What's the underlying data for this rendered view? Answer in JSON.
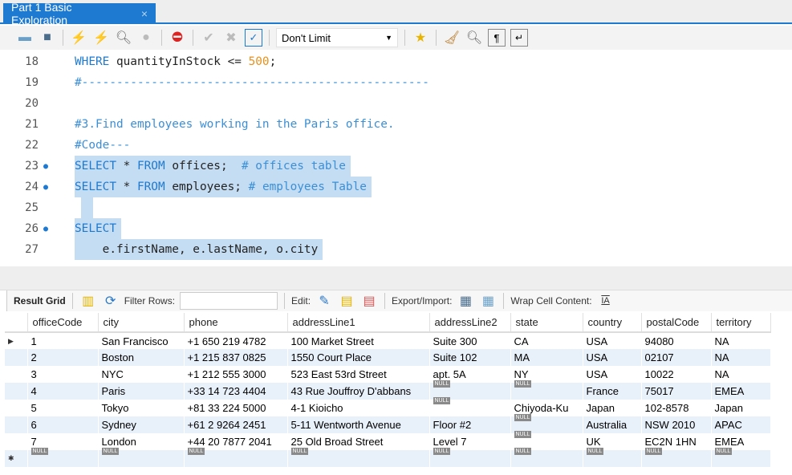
{
  "tab": {
    "title": "Part 1 Basic Exploration",
    "close": "×"
  },
  "toolbar": {
    "limit": "Don't Limit",
    "icons": [
      "open-folder-icon",
      "save-icon",
      "execute-icon",
      "execute-current-icon",
      "explain-icon",
      "stop-icon",
      "toggle-error-icon",
      "commit-icon",
      "rollback-icon",
      "autocommit-icon",
      "add-snippet-icon",
      "beautify-icon",
      "find-icon",
      "invisible-chars-icon",
      "wrap-icon"
    ]
  },
  "editor": {
    "lines": [
      {
        "n": "18",
        "dot": false,
        "sel": false,
        "tokens": [
          [
            "kw",
            "WHERE "
          ],
          [
            "id",
            "quantityInStock <= "
          ],
          [
            "num",
            "500"
          ],
          [
            "id",
            ";"
          ]
        ]
      },
      {
        "n": "19",
        "dot": false,
        "sel": false,
        "tokens": [
          [
            "cm",
            "#--------------------------------------------------"
          ]
        ]
      },
      {
        "n": "20",
        "dot": false,
        "sel": false,
        "tokens": []
      },
      {
        "n": "21",
        "dot": false,
        "sel": false,
        "tokens": [
          [
            "cm",
            "#3.Find employees working in the Paris office."
          ]
        ]
      },
      {
        "n": "22",
        "dot": false,
        "sel": false,
        "tokens": [
          [
            "cm",
            "#Code---"
          ]
        ]
      },
      {
        "n": "23",
        "dot": true,
        "sel": true,
        "tokens": [
          [
            "kw",
            "SELECT "
          ],
          [
            "id",
            "* "
          ],
          [
            "kw",
            "FROM "
          ],
          [
            "id",
            "offices;  "
          ],
          [
            "cm",
            "# offices table"
          ]
        ]
      },
      {
        "n": "24",
        "dot": true,
        "sel": true,
        "tokens": [
          [
            "kw",
            "SELECT "
          ],
          [
            "id",
            "* "
          ],
          [
            "kw",
            "FROM "
          ],
          [
            "id",
            "employees; "
          ],
          [
            "cm",
            "# employees Table"
          ]
        ]
      },
      {
        "n": "25",
        "dot": false,
        "sel": true,
        "tokens": [
          [
            "id",
            " "
          ]
        ]
      },
      {
        "n": "26",
        "dot": true,
        "sel": true,
        "tokens": [
          [
            "kw",
            "SELECT"
          ]
        ]
      },
      {
        "n": "27",
        "dot": false,
        "sel": true,
        "tokens": [
          [
            "id",
            "    e.firstName, e.lastName, o.city"
          ]
        ]
      }
    ]
  },
  "result_toolbar": {
    "result_grid": "Result Grid",
    "filter_rows": "Filter Rows:",
    "edit": "Edit:",
    "export_import": "Export/Import:",
    "wrap": "Wrap Cell Content:"
  },
  "grid": {
    "columns": [
      "officeCode",
      "city",
      "phone",
      "addressLine1",
      "addressLine2",
      "state",
      "country",
      "postalCode",
      "territory"
    ],
    "null_label": "NULL",
    "rows": [
      [
        "1",
        "San Francisco",
        "+1 650 219 4782",
        "100 Market Street",
        "Suite 300",
        "CA",
        "USA",
        "94080",
        "NA"
      ],
      [
        "2",
        "Boston",
        "+1 215 837 0825",
        "1550 Court Place",
        "Suite 102",
        "MA",
        "USA",
        "02107",
        "NA"
      ],
      [
        "3",
        "NYC",
        "+1 212 555 3000",
        "523 East 53rd Street",
        "apt. 5A",
        "NY",
        "USA",
        "10022",
        "NA"
      ],
      [
        "4",
        "Paris",
        "+33 14 723 4404",
        "43 Rue Jouffroy D'abbans",
        null,
        null,
        "France",
        "75017",
        "EMEA"
      ],
      [
        "5",
        "Tokyo",
        "+81 33 224 5000",
        "4-1 Kioicho",
        null,
        "Chiyoda-Ku",
        "Japan",
        "102-8578",
        "Japan"
      ],
      [
        "6",
        "Sydney",
        "+61 2 9264 2451",
        "5-11 Wentworth Avenue",
        "Floor #2",
        null,
        "Australia",
        "NSW 2010",
        "APAC"
      ],
      [
        "7",
        "London",
        "+44 20 7877 2041",
        "25 Old Broad Street",
        "Level 7",
        null,
        "UK",
        "EC2N 1HN",
        "EMEA"
      ]
    ]
  }
}
